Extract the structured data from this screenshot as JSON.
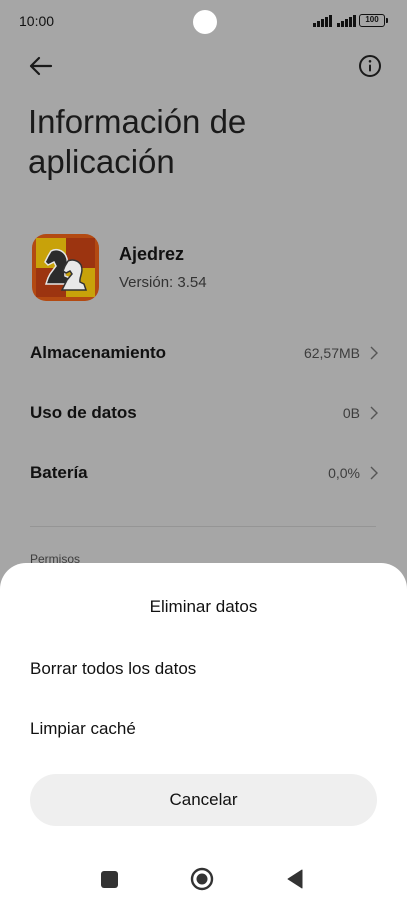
{
  "status_bar": {
    "time": "10:00",
    "battery": "100"
  },
  "header": {
    "back_icon": "arrow-left-icon",
    "info_icon": "info-circle-icon"
  },
  "page": {
    "title": "Información de aplicación"
  },
  "app": {
    "name": "Ajedrez",
    "version": "Versión: 3.54",
    "icon": "chess-knight-icon"
  },
  "rows": [
    {
      "label": "Almacenamiento",
      "value": "62,57MB"
    },
    {
      "label": "Uso de datos",
      "value": "0B"
    },
    {
      "label": "Batería",
      "value": "0,0%"
    }
  ],
  "section": {
    "permissions_label": "Permisos"
  },
  "sheet": {
    "title": "Eliminar datos",
    "items": [
      "Borrar todos los datos",
      "Limpiar caché"
    ],
    "cancel_label": "Cancelar"
  },
  "nav": {
    "recent_icon": "square-icon",
    "home_icon": "circle-icon",
    "back_icon": "triangle-back-icon"
  },
  "colors": {
    "scrim": "#a6a6a6",
    "sheet_bg": "#ffffff",
    "button_bg": "#efefef"
  }
}
